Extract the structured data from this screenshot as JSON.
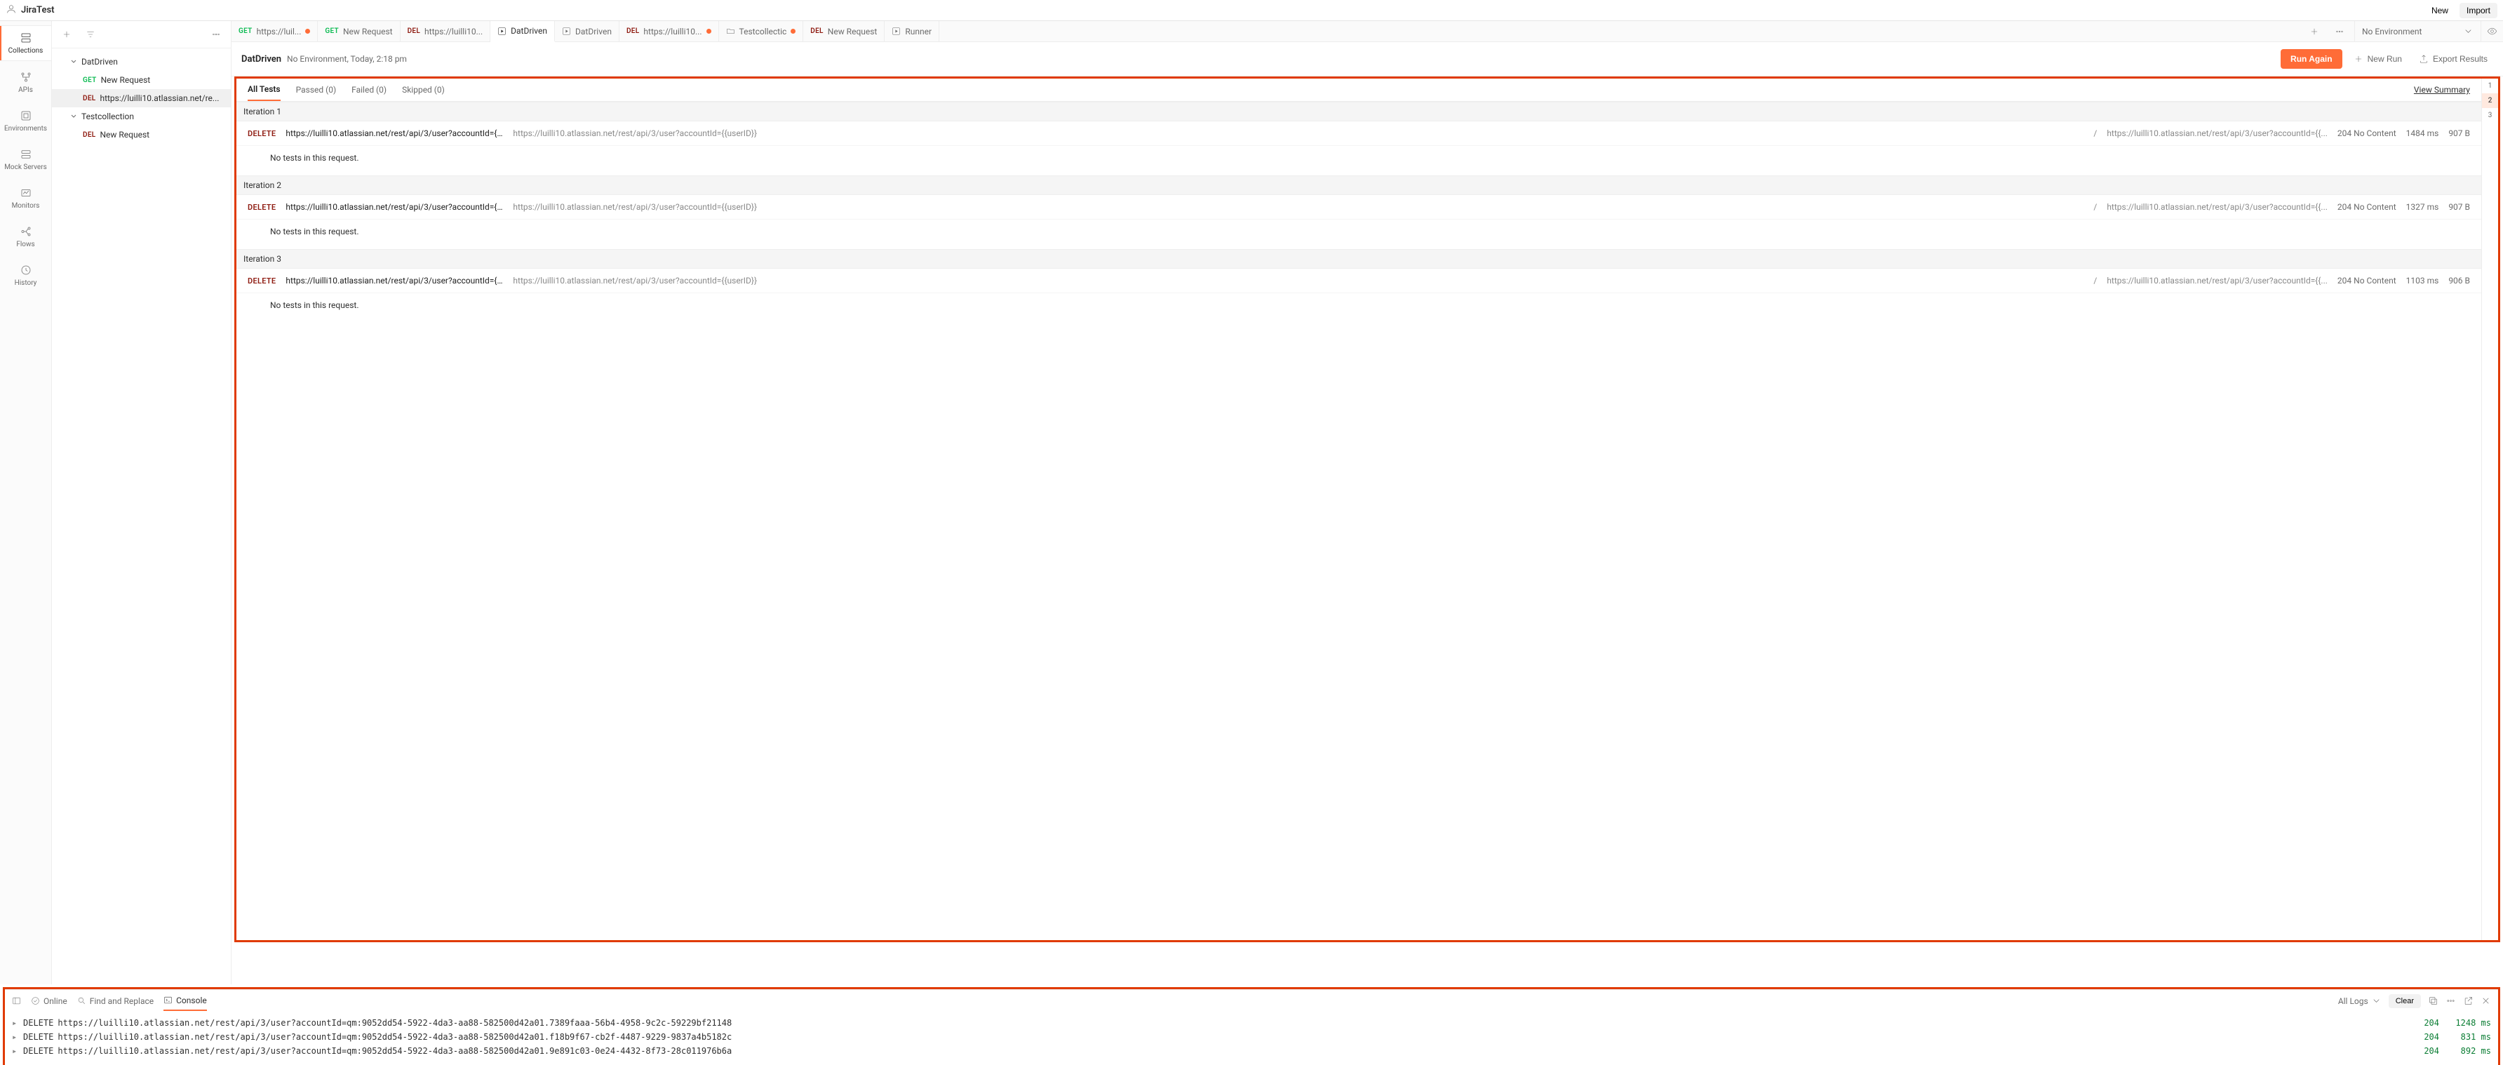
{
  "header": {
    "workspace": "JiraTest",
    "new_btn": "New",
    "import_btn": "Import"
  },
  "nav": {
    "collections": "Collections",
    "apis": "APIs",
    "environments": "Environments",
    "mock_servers": "Mock Servers",
    "monitors": "Monitors",
    "flows": "Flows",
    "history": "History"
  },
  "sidebar": {
    "items": [
      {
        "type": "folder",
        "label": "DatDriven"
      },
      {
        "type": "req",
        "method": "GET",
        "label": "New Request"
      },
      {
        "type": "req",
        "method": "DEL",
        "label": "https://luilli10.atlassian.net/re...",
        "selected": true
      },
      {
        "type": "folder",
        "label": "Testcollection"
      },
      {
        "type": "req",
        "method": "DEL",
        "label": "New Request"
      }
    ]
  },
  "tabs": [
    {
      "method": "GET",
      "label": "https://luil...",
      "dot": true
    },
    {
      "method": "GET",
      "label": "New Request"
    },
    {
      "method": "DEL",
      "label": "https://luilli10..."
    },
    {
      "icon": "play",
      "label": "DatDriven",
      "active": true
    },
    {
      "icon": "play",
      "label": "DatDriven"
    },
    {
      "method": "DEL",
      "label": "https://luilli10...",
      "dot": true
    },
    {
      "icon": "folder",
      "label": "Testcollectic",
      "dot": true
    },
    {
      "method": "DEL",
      "label": "New Request"
    },
    {
      "icon": "play",
      "label": "Runner"
    }
  ],
  "env": {
    "label": "No Environment"
  },
  "runner": {
    "title": "DatDriven",
    "subtitle": "No Environment, Today, 2:18 pm",
    "run_again": "Run Again",
    "new_run": "New Run",
    "export": "Export Results"
  },
  "results_tabs": {
    "all": "All Tests",
    "passed": "Passed (0)",
    "failed": "Failed (0)",
    "skipped": "Skipped (0)",
    "view_summary": "View Summary"
  },
  "iterations": [
    {
      "label": "Iteration 1",
      "method": "DELETE",
      "url1": "https://luilli10.atlassian.net/rest/api/3/user?accountId={{use...",
      "url2": "https://luilli10.atlassian.net/rest/api/3/user?accountId={{userID}}",
      "url3": "https://luilli10.atlassian.net/rest/api/3/user?accountId={{...",
      "status": "204 No Content",
      "time": "1484 ms",
      "size": "907 B",
      "no_tests": "No tests in this request."
    },
    {
      "label": "Iteration 2",
      "method": "DELETE",
      "url1": "https://luilli10.atlassian.net/rest/api/3/user?accountId={{use...",
      "url2": "https://luilli10.atlassian.net/rest/api/3/user?accountId={{userID}}",
      "url3": "https://luilli10.atlassian.net/rest/api/3/user?accountId={{...",
      "status": "204 No Content",
      "time": "1327 ms",
      "size": "907 B",
      "no_tests": "No tests in this request."
    },
    {
      "label": "Iteration 3",
      "method": "DELETE",
      "url1": "https://luilli10.atlassian.net/rest/api/3/user?accountId={{use...",
      "url2": "https://luilli10.atlassian.net/rest/api/3/user?accountId={{userID}}",
      "url3": "https://luilli10.atlassian.net/rest/api/3/user?accountId={{...",
      "status": "204 No Content",
      "time": "1103 ms",
      "size": "906 B",
      "no_tests": "No tests in this request."
    }
  ],
  "gutter": [
    "1",
    "2",
    "3"
  ],
  "console_bar": {
    "online": "Online",
    "find": "Find and Replace",
    "console": "Console",
    "all_logs": "All Logs",
    "clear": "Clear"
  },
  "console_logs": [
    {
      "method": "DELETE",
      "url": "https://luilli10.atlassian.net/rest/api/3/user?accountId=qm:9052dd54-5922-4da3-aa88-582500d42a01.7389faaa-56b4-4958-9c2c-59229bf21148",
      "code": "204",
      "time": "1248 ms"
    },
    {
      "method": "DELETE",
      "url": "https://luilli10.atlassian.net/rest/api/3/user?accountId=qm:9052dd54-5922-4da3-aa88-582500d42a01.f18b9f67-cb2f-4487-9229-9837a4b5182c",
      "code": "204",
      "time": "831 ms"
    },
    {
      "method": "DELETE",
      "url": "https://luilli10.atlassian.net/rest/api/3/user?accountId=qm:9052dd54-5922-4da3-aa88-582500d42a01.9e891c03-0e24-4432-8f73-28c011976b6a",
      "code": "204",
      "time": "892 ms"
    }
  ]
}
